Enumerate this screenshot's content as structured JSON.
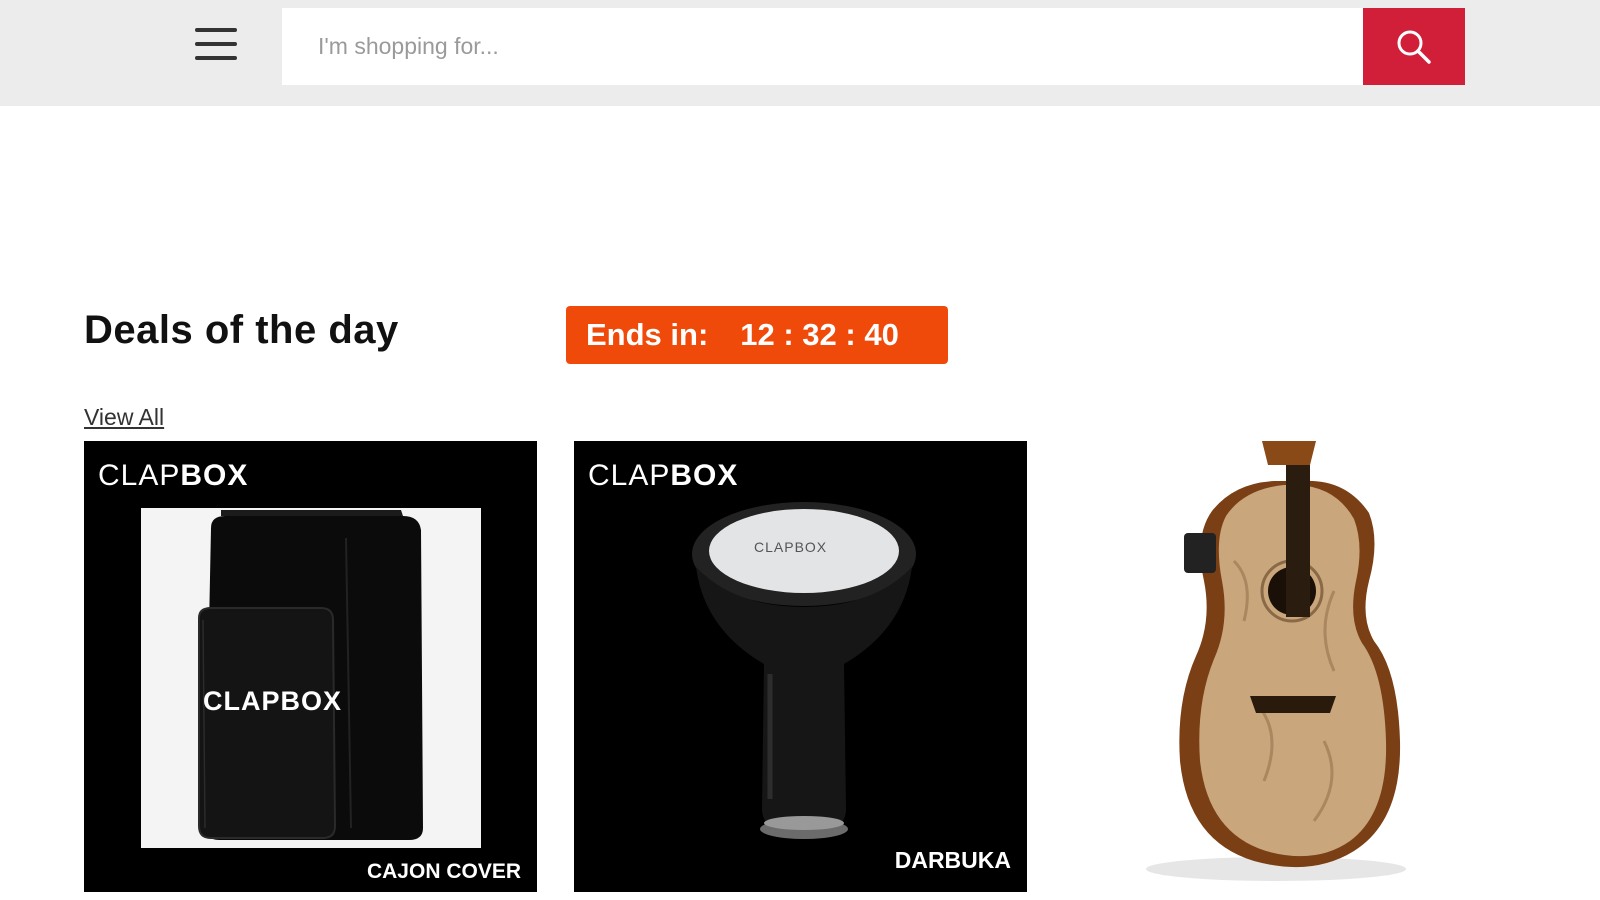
{
  "header": {
    "menu_icon": "hamburger-menu-icon",
    "search": {
      "placeholder": "I'm shopping for...",
      "value": ""
    },
    "search_icon": "search-icon",
    "accent_color": "#d11f3a"
  },
  "deals": {
    "title": "Deals of the day",
    "countdown": {
      "label": "Ends in:",
      "time": "12 : 32 : 40",
      "color": "#f04a0b"
    },
    "view_all": "View All"
  },
  "products": [
    {
      "brand_light": "CLAP",
      "brand_bold": "BOX",
      "caption": "CAJON COVER",
      "image": "cajon-cover-bag",
      "bag_brand": "CLAPBOX"
    },
    {
      "brand_light": "CLAP",
      "brand_bold": "BOX",
      "caption": "DARBUKA",
      "image": "darbuka-drum",
      "drum_brand": "CLAPBOX"
    },
    {
      "image": "acoustic-guitar"
    }
  ]
}
